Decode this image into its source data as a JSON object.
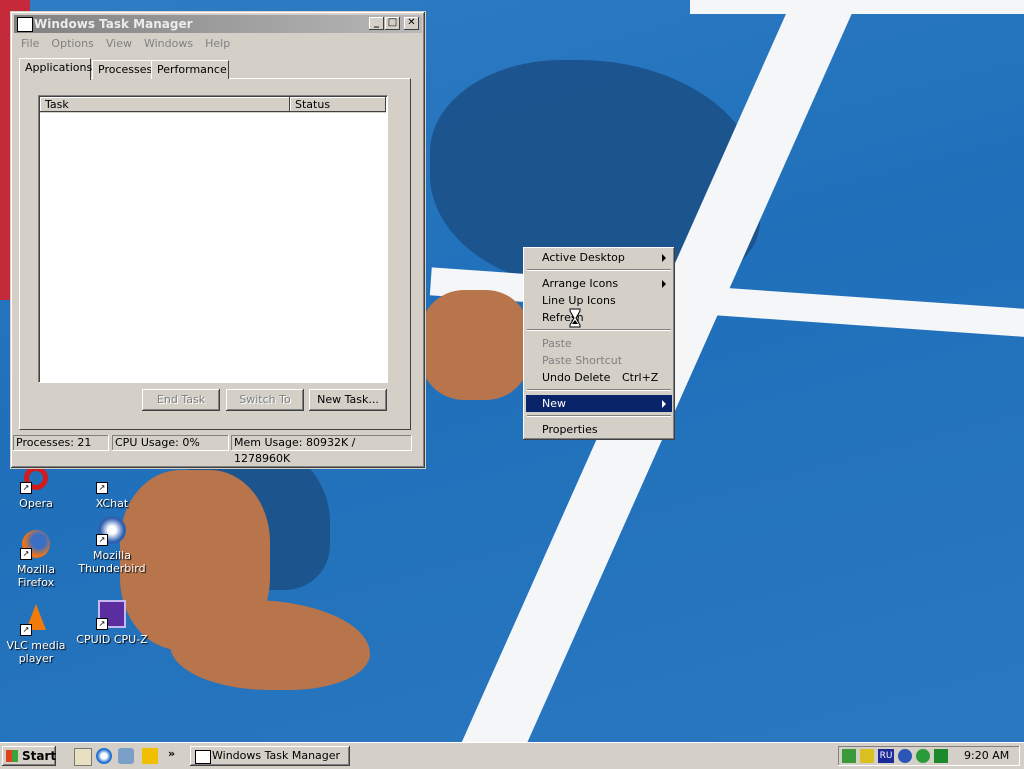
{
  "window": {
    "title": "Windows Task Manager",
    "menu": [
      "File",
      "Options",
      "View",
      "Windows",
      "Help"
    ],
    "tabs": [
      "Applications",
      "Processes",
      "Performance"
    ],
    "active_tab": "Applications",
    "columns": [
      "Task",
      "Status"
    ],
    "buttons": {
      "end_task": "End Task",
      "switch_to": "Switch To",
      "new_task": "New Task..."
    },
    "status": {
      "processes": "Processes: 21",
      "cpu": "CPU Usage: 0%",
      "mem": "Mem Usage: 80932K / 1278960K"
    }
  },
  "context_menu": {
    "active_desktop": "Active Desktop",
    "arrange_icons": "Arrange Icons",
    "line_up_icons": "Line Up Icons",
    "refresh": "Refresh",
    "paste": "Paste",
    "paste_shortcut": "Paste Shortcut",
    "undo_delete": "Undo Delete",
    "undo_delete_shortcut": "Ctrl+Z",
    "new": "New",
    "properties": "Properties"
  },
  "desktop_icons": {
    "opera": "Opera",
    "xchat": "XChat",
    "firefox": "Mozilla Firefox",
    "thunderbird": "Mozilla Thunderbird",
    "vlc": "VLC media player",
    "cpuz": "CPUID CPU-Z"
  },
  "taskbar": {
    "start": "Start",
    "task_button": "Windows Task Manager",
    "language": "RU",
    "clock": "9:20 AM",
    "overflow": "»"
  }
}
